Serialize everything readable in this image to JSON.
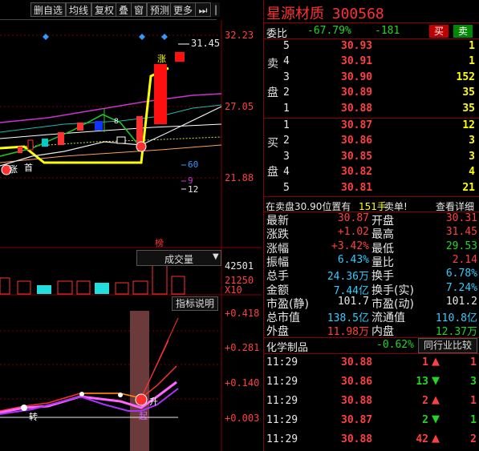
{
  "toolbar": {
    "buttons": [
      "删自选",
      "均线",
      "复权",
      "叠",
      "窗",
      "预测",
      "更多"
    ],
    "nav_icon": "step-forward-icon",
    "close_icon": "close-icon"
  },
  "chart": {
    "price_labels": [
      "32.23",
      "27.05",
      "21.88"
    ],
    "indicator_labels": [
      "+0.418",
      "+0.281",
      "+0.140",
      "+0.003"
    ],
    "volume_labels": [
      "42501",
      "21250",
      "X10"
    ],
    "high_marker": "31.45",
    "main_tags": [
      "涨",
      "首",
      "涨",
      "8"
    ],
    "ma_labels": [
      "60",
      "9",
      "12"
    ],
    "bang_label": "榜",
    "volume_selector": "成交量",
    "indicator_button": "指标说明",
    "ind_tags": [
      "转",
      "升",
      "起"
    ]
  },
  "stock": {
    "name": "星源材质",
    "code": "300568",
    "weibi_label": "委比",
    "weibi_pct": "-67.79%",
    "weibi_diff": "-181",
    "buy_btn": "买",
    "sell_btn": "卖"
  },
  "sell_orders": [
    {
      "level": "5",
      "price": "30.93",
      "vol": "1"
    },
    {
      "level": "4",
      "price": "30.91",
      "vol": "1"
    },
    {
      "level": "3",
      "price": "30.90",
      "vol": "152"
    },
    {
      "level": "2",
      "price": "30.89",
      "vol": "35"
    },
    {
      "level": "1",
      "price": "30.88",
      "vol": "35"
    }
  ],
  "sell_side_chars": [
    "卖",
    "盘"
  ],
  "buy_orders": [
    {
      "level": "1",
      "price": "30.87",
      "vol": "12"
    },
    {
      "level": "2",
      "price": "30.86",
      "vol": "3"
    },
    {
      "level": "3",
      "price": "30.85",
      "vol": "3"
    },
    {
      "level": "4",
      "price": "30.82",
      "vol": "4"
    },
    {
      "level": "5",
      "price": "30.81",
      "vol": "21"
    }
  ],
  "buy_side_chars": [
    "买",
    "盘"
  ],
  "notice": {
    "prefix": "在卖盘30.90位置有",
    "qty": "151手",
    "suffix": "卖单!",
    "detail": "查看详细"
  },
  "quote": [
    {
      "l": "最新",
      "lv": "30.87",
      "r": "开盘",
      "rv": "30.31",
      "lc": "red",
      "rc": "red"
    },
    {
      "l": "涨跌",
      "lv": "+1.02",
      "r": "最高",
      "rv": "31.45",
      "lc": "red",
      "rc": "red"
    },
    {
      "l": "涨幅",
      "lv": "+3.42%",
      "r": "最低",
      "rv": "29.53",
      "lc": "red",
      "rc": "green"
    },
    {
      "l": "振幅",
      "lv": "6.43%",
      "r": "量比",
      "rv": "2.14",
      "lc": "cyan",
      "rc": "red"
    },
    {
      "l": "总手",
      "lv": "24.36万",
      "r": "换手",
      "rv": "6.78%",
      "lc": "cyan",
      "rc": "cyan"
    },
    {
      "l": "金额",
      "lv": "7.44亿",
      "r": "换手(实)",
      "rv": "7.24%",
      "lc": "cyan",
      "rc": "cyan"
    },
    {
      "l": "市盈(静)",
      "lv": "101.7",
      "r": "市盈(动)",
      "rv": "101.2",
      "lc": "white",
      "rc": "white"
    },
    {
      "l": "总市值",
      "lv": "138.5亿",
      "r": "流通值",
      "rv": "110.8亿",
      "lc": "cyan",
      "rc": "cyan"
    },
    {
      "l": "外盘",
      "lv": "11.98万",
      "r": "内盘",
      "rv": "12.37万",
      "lc": "red",
      "rc": "green"
    }
  ],
  "sector": {
    "name": "化学制品",
    "pct": "-0.62%",
    "compare_btn": "同行业比较"
  },
  "ticks": [
    {
      "time": "11:29",
      "price": "30.88",
      "vol": "1",
      "dir": "up",
      "num": "1",
      "pc": "red",
      "vc": "red"
    },
    {
      "time": "11:29",
      "price": "30.86",
      "vol": "13",
      "dir": "down",
      "num": "3",
      "pc": "red",
      "vc": "green"
    },
    {
      "time": "11:29",
      "price": "30.88",
      "vol": "2",
      "dir": "up",
      "num": "1",
      "pc": "red",
      "vc": "red"
    },
    {
      "time": "11:29",
      "price": "30.87",
      "vol": "2",
      "dir": "down",
      "num": "1",
      "pc": "red",
      "vc": "green"
    },
    {
      "time": "11:29",
      "price": "30.88",
      "vol": "42",
      "dir": "up",
      "num": "2",
      "pc": "red",
      "vc": "red"
    }
  ]
}
